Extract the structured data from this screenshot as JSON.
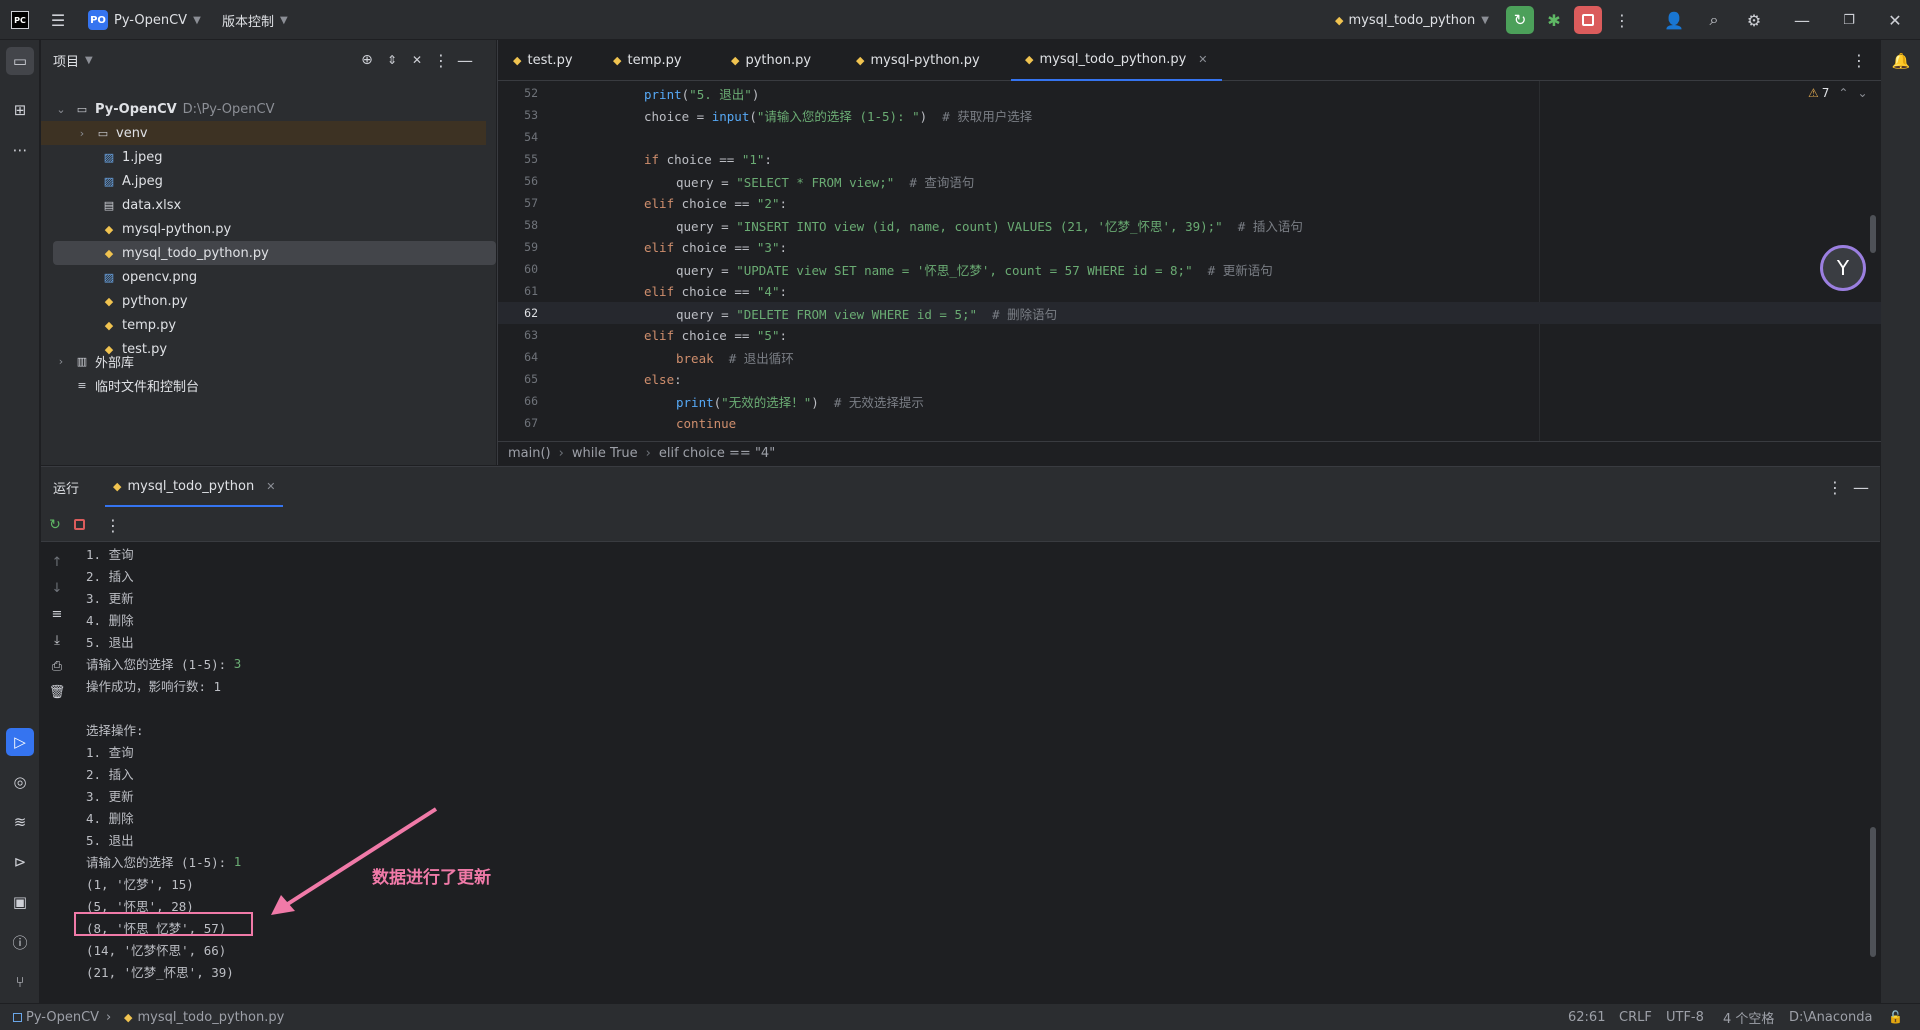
{
  "titlebar": {
    "app_logo": "PC",
    "project_badge": "PO",
    "project_name": "Py-OpenCV",
    "vcs_label": "版本控制",
    "run_config": "mysql_todo_python"
  },
  "project_panel": {
    "title": "项目",
    "root_name": "Py-OpenCV",
    "root_path": "D:\\Py-OpenCV",
    "items": [
      {
        "label": "venv",
        "kind": "folder"
      },
      {
        "label": "1.jpeg",
        "kind": "image"
      },
      {
        "label": "A.jpeg",
        "kind": "image"
      },
      {
        "label": "data.xlsx",
        "kind": "file"
      },
      {
        "label": "mysql-python.py",
        "kind": "python"
      },
      {
        "label": "mysql_todo_python.py",
        "kind": "python"
      },
      {
        "label": "opencv.png",
        "kind": "image"
      },
      {
        "label": "python.py",
        "kind": "python"
      },
      {
        "label": "temp.py",
        "kind": "python"
      },
      {
        "label": "test.py",
        "kind": "python"
      }
    ],
    "external_libs": "外部库",
    "scratches": "临时文件和控制台"
  },
  "editor": {
    "tabs": [
      "test.py",
      "temp.py",
      "python.py",
      "mysql-python.py",
      "mysql_todo_python.py"
    ],
    "active_tab": "mysql_todo_python.py",
    "warnings": "7",
    "breadcrumb": [
      "main()",
      "while True",
      "elif choice == \"4\""
    ],
    "lines": [
      {
        "n": "52",
        "indent": 2,
        "parts": [
          [
            "fn",
            "print"
          ],
          [
            "tx",
            "("
          ],
          [
            "str",
            "\"5. 退出\""
          ],
          [
            "tx",
            ")"
          ]
        ]
      },
      {
        "n": "53",
        "indent": 2,
        "parts": [
          [
            "tx",
            "choice = "
          ],
          [
            "fn",
            "input"
          ],
          [
            "tx",
            "("
          ],
          [
            "str",
            "\"请输入您的选择 (1-5): \""
          ],
          [
            "tx",
            ")  "
          ],
          [
            "cm",
            "# 获取用户选择"
          ]
        ]
      },
      {
        "n": "54",
        "indent": 0,
        "parts": []
      },
      {
        "n": "55",
        "indent": 2,
        "parts": [
          [
            "kw",
            "if "
          ],
          [
            "tx",
            "choice == "
          ],
          [
            "str",
            "\"1\""
          ],
          [
            "tx",
            ":"
          ]
        ]
      },
      {
        "n": "56",
        "indent": 3,
        "parts": [
          [
            "tx",
            "query = "
          ],
          [
            "str",
            "\"SELECT * FROM view;\""
          ],
          [
            "tx",
            "  "
          ],
          [
            "cm",
            "# 查询语句"
          ]
        ]
      },
      {
        "n": "57",
        "indent": 2,
        "parts": [
          [
            "kw",
            "elif "
          ],
          [
            "tx",
            "choice == "
          ],
          [
            "str",
            "\"2\""
          ],
          [
            "tx",
            ":"
          ]
        ]
      },
      {
        "n": "58",
        "indent": 3,
        "parts": [
          [
            "tx",
            "query = "
          ],
          [
            "str",
            "\"INSERT INTO view (id, name, count) VALUES (21, '忆梦_怀思', 39);\""
          ],
          [
            "tx",
            "  "
          ],
          [
            "cm",
            "# 插入语句"
          ]
        ]
      },
      {
        "n": "59",
        "indent": 2,
        "parts": [
          [
            "kw",
            "elif "
          ],
          [
            "tx",
            "choice == "
          ],
          [
            "str",
            "\"3\""
          ],
          [
            "tx",
            ":"
          ]
        ]
      },
      {
        "n": "60",
        "indent": 3,
        "parts": [
          [
            "tx",
            "query = "
          ],
          [
            "str",
            "\"UPDATE view SET name = '怀思_忆梦', count = 57 WHERE id = 8;\""
          ],
          [
            "tx",
            "  "
          ],
          [
            "cm",
            "# 更新语句"
          ]
        ]
      },
      {
        "n": "61",
        "indent": 2,
        "parts": [
          [
            "kw",
            "elif "
          ],
          [
            "tx",
            "choice == "
          ],
          [
            "str",
            "\"4\""
          ],
          [
            "tx",
            ":"
          ]
        ]
      },
      {
        "n": "62",
        "indent": 3,
        "parts": [
          [
            "tx",
            "query = "
          ],
          [
            "str",
            "\"DELETE FROM view WHERE id = 5;\""
          ],
          [
            "tx",
            "  "
          ],
          [
            "cm",
            "# 删除语句"
          ]
        ]
      },
      {
        "n": "63",
        "indent": 2,
        "parts": [
          [
            "kw",
            "elif "
          ],
          [
            "tx",
            "choice == "
          ],
          [
            "str",
            "\"5\""
          ],
          [
            "tx",
            ":"
          ]
        ]
      },
      {
        "n": "64",
        "indent": 3,
        "parts": [
          [
            "kw",
            "break"
          ],
          [
            "tx",
            "  "
          ],
          [
            "cm",
            "# 退出循环"
          ]
        ]
      },
      {
        "n": "65",
        "indent": 2,
        "parts": [
          [
            "kw",
            "else"
          ],
          [
            "tx",
            ":"
          ]
        ]
      },
      {
        "n": "66",
        "indent": 3,
        "parts": [
          [
            "fn",
            "print"
          ],
          [
            "tx",
            "("
          ],
          [
            "str",
            "\"无效的选择！\""
          ],
          [
            "tx",
            ")  "
          ],
          [
            "cm",
            "# 无效选择提示"
          ]
        ]
      },
      {
        "n": "67",
        "indent": 3,
        "parts": [
          [
            "kw",
            "continue"
          ]
        ]
      }
    ],
    "current_line": "62"
  },
  "run_panel": {
    "label": "运行",
    "tab": "mysql_todo_python",
    "output": [
      {
        "t": "1. 查询"
      },
      {
        "t": "2. 插入"
      },
      {
        "t": "3. 更新"
      },
      {
        "t": "4. 删除"
      },
      {
        "t": "5. 退出"
      },
      {
        "t": "请输入您的选择 (1-5): ",
        "input": "3"
      },
      {
        "t": "操作成功，影响行数: 1"
      },
      {
        "t": ""
      },
      {
        "t": "选择操作:"
      },
      {
        "t": "1. 查询"
      },
      {
        "t": "2. 插入"
      },
      {
        "t": "3. 更新"
      },
      {
        "t": "4. 删除"
      },
      {
        "t": "5. 退出"
      },
      {
        "t": "请输入您的选择 (1-5): ",
        "input": "1"
      },
      {
        "t": "(1, '忆梦', 15)"
      },
      {
        "t": "(5, '怀思', 28)"
      },
      {
        "t": "(8, '怀思_忆梦', 57)",
        "highlight": true
      },
      {
        "t": "(14, '忆梦怀思', 66)"
      },
      {
        "t": "(21, '忆梦_怀思', 39)"
      }
    ],
    "annotation": "数据进行了更新"
  },
  "statusbar": {
    "project": "Py-OpenCV",
    "file": "mysql_todo_python.py",
    "position": "62:61",
    "line_sep": "CRLF",
    "encoding": "UTF-8",
    "indent": "4 个空格",
    "interpreter": "D:\\Anaconda"
  },
  "colors": {
    "accent": "#3574f0",
    "annotation": "#f07aa8",
    "run_green": "#4ca05a",
    "stop_red": "#db5c5c"
  }
}
